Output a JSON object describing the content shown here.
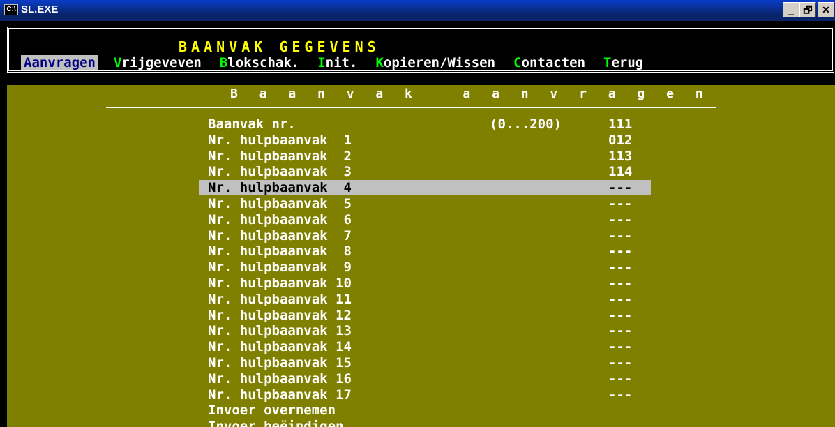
{
  "window": {
    "title": "SL.EXE",
    "icon": "console-icon",
    "controls": {
      "minimize": "_",
      "maximize": "🗗",
      "close": "✕"
    }
  },
  "app": {
    "header_title": "BAANVAK GEGEVENS",
    "menu": [
      {
        "hotkey": "A",
        "rest": "anvragen",
        "active": true
      },
      {
        "hotkey": "V",
        "rest": "rijgeveven",
        "active": false
      },
      {
        "hotkey": "B",
        "rest": "lokschak.",
        "active": false
      },
      {
        "hotkey": "I",
        "rest": "nit.",
        "active": false
      },
      {
        "hotkey": "K",
        "rest": "opieren/Wissen",
        "active": false
      },
      {
        "hotkey": "C",
        "rest": "ontacten",
        "active": false
      },
      {
        "hotkey": "T",
        "rest": "erug",
        "active": false
      }
    ],
    "section_title": "Baanvak aanvragen",
    "section_title_display": "B a a n v a k   a a n v r a g e n",
    "rows": [
      {
        "label": "Baanvak nr.",
        "hint": "(0...200)",
        "value": "111"
      },
      {
        "label": "Nr. hulpbaanvak  1",
        "hint": "",
        "value": "012"
      },
      {
        "label": "Nr. hulpbaanvak  2",
        "hint": "",
        "value": "113"
      },
      {
        "label": "Nr. hulpbaanvak  3",
        "hint": "",
        "value": "114"
      },
      {
        "label": "Nr. hulpbaanvak  4",
        "hint": "",
        "value": "---",
        "selected": true
      },
      {
        "label": "Nr. hulpbaanvak  5",
        "hint": "",
        "value": "---"
      },
      {
        "label": "Nr. hulpbaanvak  6",
        "hint": "",
        "value": "---"
      },
      {
        "label": "Nr. hulpbaanvak  7",
        "hint": "",
        "value": "---"
      },
      {
        "label": "Nr. hulpbaanvak  8",
        "hint": "",
        "value": "---"
      },
      {
        "label": "Nr. hulpbaanvak  9",
        "hint": "",
        "value": "---"
      },
      {
        "label": "Nr. hulpbaanvak 10",
        "hint": "",
        "value": "---"
      },
      {
        "label": "Nr. hulpbaanvak 11",
        "hint": "",
        "value": "---"
      },
      {
        "label": "Nr. hulpbaanvak 12",
        "hint": "",
        "value": "---"
      },
      {
        "label": "Nr. hulpbaanvak 13",
        "hint": "",
        "value": "---"
      },
      {
        "label": "Nr. hulpbaanvak 14",
        "hint": "",
        "value": "---"
      },
      {
        "label": "Nr. hulpbaanvak 15",
        "hint": "",
        "value": "---"
      },
      {
        "label": "Nr. hulpbaanvak 16",
        "hint": "",
        "value": "---"
      },
      {
        "label": "Nr. hulpbaanvak 17",
        "hint": "",
        "value": "---"
      },
      {
        "label": "Invoer overnemen",
        "hint": "",
        "value": ""
      },
      {
        "label": "Invoer beëindigen",
        "hint": "",
        "value": ""
      }
    ],
    "colors": {
      "background": "#808000",
      "hotkey": "#00ff00",
      "title": "#ffff00",
      "selection": "#c0c0c0",
      "active_menu_text": "#000080"
    }
  }
}
